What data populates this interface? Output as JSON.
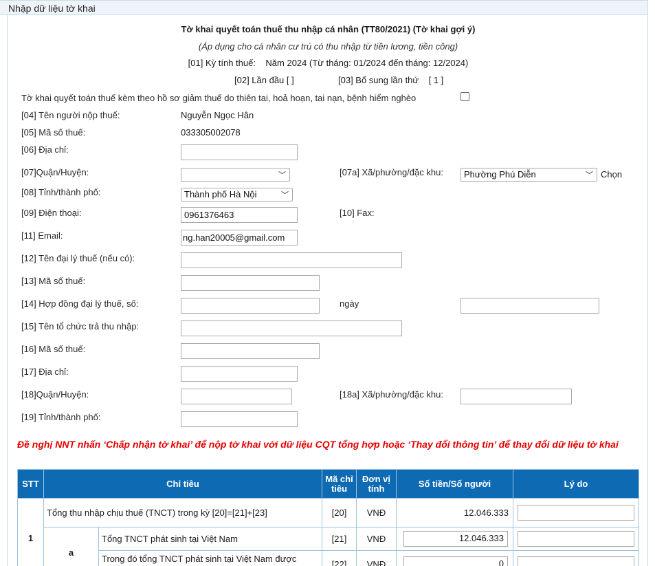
{
  "panel_title": "Nhập dữ liệu tờ khai",
  "header": {
    "title": "Tờ khai quyết toán thuế thu nhập cá nhân (TT80/2021) (Tờ khai gợi ý)",
    "subtitle": "(Áp dụng cho cá nhân cư trú có thu nhập từ tiền lương, tiền công)",
    "period_label": "[01] Kỳ tính thuế:",
    "period_value": "Năm 2024 (Từ tháng: 01/2024 đến tháng: 12/2024)",
    "first_time": "[02] Lần đầu [ ]",
    "supplement_label": "[03] Bổ sung lần thứ",
    "supplement_value": "[ 1 ]"
  },
  "disaster_checkbox_label": "Tờ khai quyết toán thuế kèm theo hồ sơ giảm thuế do thiên tai, hoả hoạn, tai nạn, bệnh hiểm nghèo",
  "fields": {
    "taxpayer_name_label": "[04] Tên người nộp thuế:",
    "taxpayer_name_value": "Nguyễn Ngọc Hân",
    "tax_code_label": "[05] Mã số thuế:",
    "tax_code_value": "033305002078",
    "address_label": "[06] Địa chỉ:",
    "address_value": "",
    "district_label": "[07]Quận/Huyện:",
    "district_value": "",
    "ward_label": "[07a] Xã/phường/đặc khu:",
    "ward_value": "Phường Phú Diễn",
    "choose_label": "Chọn",
    "province_label": "[08] Tỉnh/thành phố:",
    "province_value": "Thành phố Hà Nội",
    "phone_label": "[09] Điện thoại:",
    "phone_value": "0961376463",
    "fax_label": "[10] Fax:",
    "email_label": "[11] Email:",
    "email_value": "ng.han20005@gmail.com",
    "agent_name_label": "[12] Tên đại lý thuế (nếu có):",
    "agent_tax_code_label": "[13] Mã số thuế:",
    "agent_contract_label": "[14] Hợp đồng đại lý thuế, số:",
    "agent_contract_date_label": "ngày",
    "payer_org_label": "[15] Tên tổ chức trả thu nhập:",
    "payer_tax_code_label": "[16] Mã số thuế:",
    "payer_address_label": "[17] Địa chỉ:",
    "payer_district_label": "[18]Quận/Huyện:",
    "payer_ward_label": "[18a] Xã/phường/đặc khu:",
    "payer_province_label": "[19] Tỉnh/thành phố:"
  },
  "warning": "Đề nghị NNT nhấn ‘Chấp nhận tờ khai’ để nộp tờ khai với dữ liệu CQT tổng hợp hoặc ‘Thay đổi thông tin’ để thay đổi dữ liệu tờ khai",
  "table": {
    "headers": [
      "STT",
      "Chỉ tiêu",
      "Mã chỉ tiêu",
      "Đơn vị tính",
      "Số tiền/Số người",
      "Lý do"
    ],
    "rows": [
      {
        "stt": "1",
        "item": "Tổng thu nhập chịu thuế (TNCT) trong kỳ [20]=[21]+[23]",
        "code": "[20]",
        "unit": "VNĐ",
        "amount": "12.046.333"
      },
      {
        "sub": "a",
        "item": "Tổng TNCT phát sinh tại Việt Nam",
        "code": "[21]",
        "unit": "VNĐ",
        "amount": "12.046.333"
      },
      {
        "item": "Trong đó tổng TNCT phát sinh tại Việt Nam được",
        "code": "[22]",
        "unit": "VNĐ",
        "amount": "0"
      }
    ]
  },
  "icons": {
    "dropdown": "chevron-down-icon",
    "checkbox": "checkbox-icon"
  }
}
